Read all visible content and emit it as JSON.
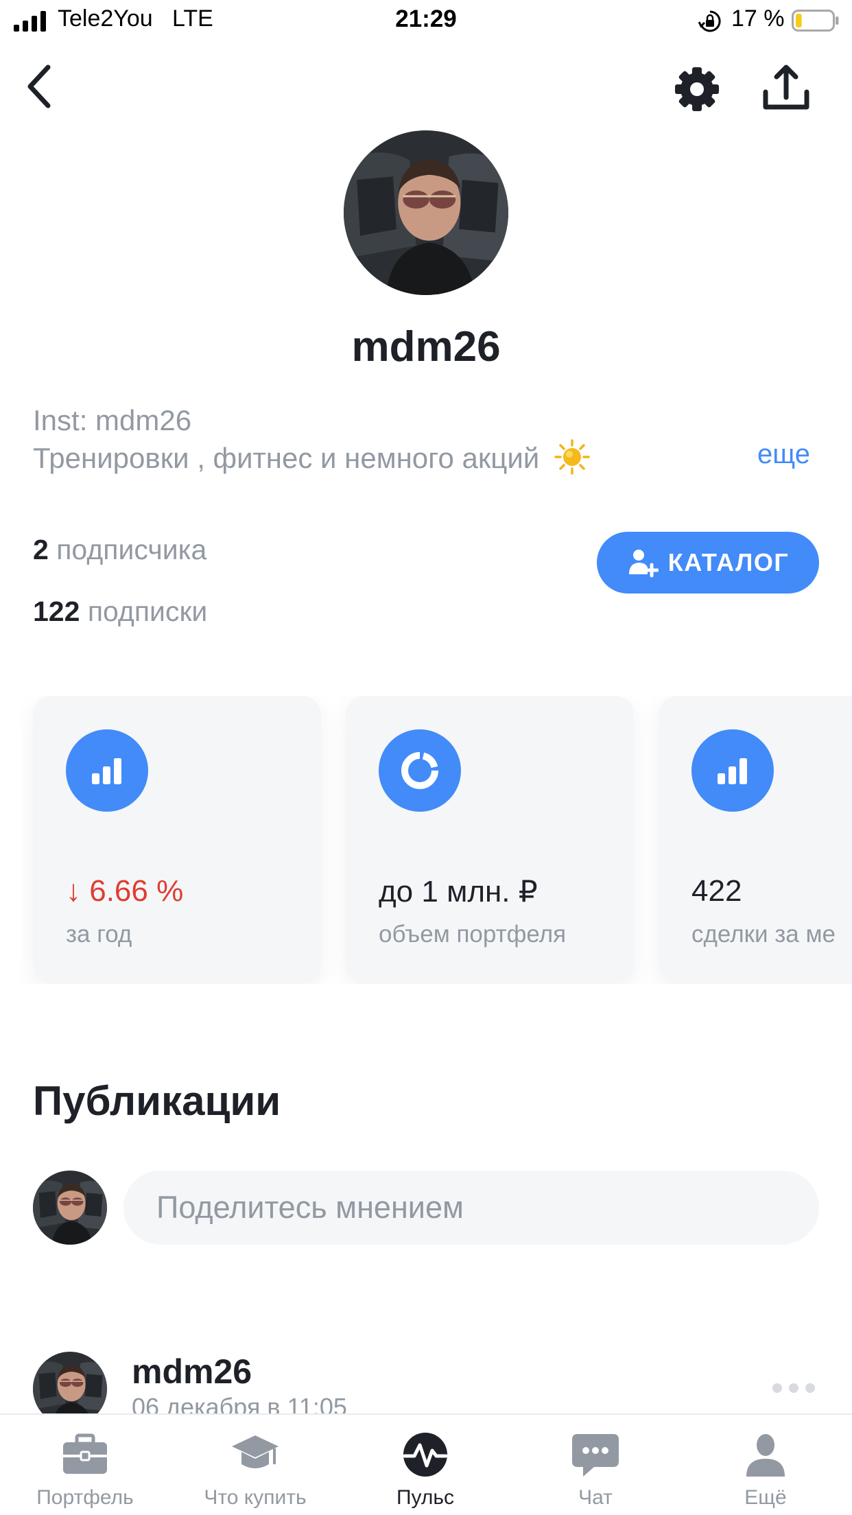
{
  "status_bar": {
    "carrier": "Tele2You",
    "network": "LTE",
    "time": "21:29",
    "battery_percent": "17 %",
    "battery_level": 0.17,
    "icons": [
      "signal-icon",
      "orientation-lock-icon",
      "battery-icon"
    ]
  },
  "nav": {
    "icons": [
      "back-icon",
      "settings-icon",
      "share-icon"
    ]
  },
  "profile": {
    "username": "mdm26",
    "bio_line1": "Inst: mdm26",
    "bio_line2": "Тренировки , фитнес и немного акций",
    "bio_emoji": "sun-icon",
    "more_label": "еще",
    "followers_count": "2",
    "followers_label": "подписчика",
    "subscriptions_count": "122",
    "subscriptions_label": "подписки",
    "catalog_button": "КАТАЛОГ"
  },
  "cards": [
    {
      "icon": "bar-chart-icon",
      "arrow": "↓",
      "value": "6.66 %",
      "label": "за год",
      "value_color": "#e03c31"
    },
    {
      "icon": "donut-chart-icon",
      "value": "до 1 млн. ₽",
      "label": "объем портфеля"
    },
    {
      "icon": "bar-chart-icon",
      "value": "422",
      "label": "сделки за ме"
    }
  ],
  "publications": {
    "title": "Публикации",
    "composer_placeholder": "Поделитесь мнением",
    "post": {
      "author": "mdm26",
      "date": "06 декабря в 11:05"
    }
  },
  "tab_bar": {
    "tabs": [
      {
        "label": "Портфель",
        "icon": "briefcase-icon"
      },
      {
        "label": "Что купить",
        "icon": "graduation-cap-icon"
      },
      {
        "label": "Пульс",
        "icon": "pulse-icon",
        "active": true
      },
      {
        "label": "Чат",
        "icon": "chat-icon"
      },
      {
        "label": "Ещё",
        "icon": "profile-icon"
      }
    ]
  },
  "colors": {
    "accent": "#428bf9",
    "negative": "#e03c31",
    "text_primary": "#1e2128",
    "text_secondary": "#9299a2",
    "surface": "#f5f6f8"
  }
}
